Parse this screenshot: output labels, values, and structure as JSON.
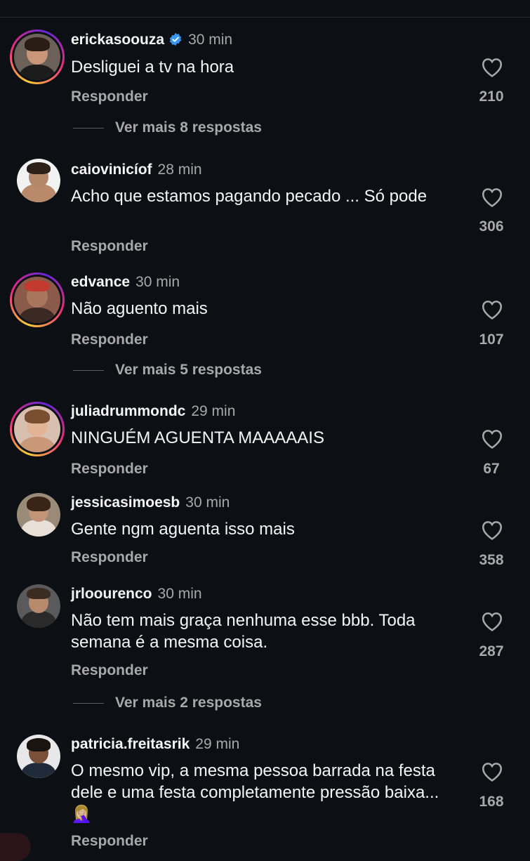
{
  "reply_label": "Responder",
  "comments": [
    {
      "user": "erickasoouza",
      "time": "30 min",
      "verified": true,
      "text": "Desliguei a tv na hora",
      "likes": "210",
      "more": "Ver mais 8 respostas"
    },
    {
      "user": "caiovinicíof",
      "time": "28 min",
      "verified": false,
      "text": "Acho que estamos pagando  pecado ... Só pode",
      "likes": "306"
    },
    {
      "user": "edvance",
      "time": "30 min",
      "verified": false,
      "text": "Não aguento mais",
      "likes": "107",
      "more": "Ver mais 5 respostas"
    },
    {
      "user": "juliadrummondc",
      "time": "29 min",
      "verified": false,
      "text": "NINGUÉM AGUENTA MAAAAAIS",
      "likes": "67"
    },
    {
      "user": "jessicasimoesb",
      "time": "30 min",
      "verified": false,
      "text": "Gente ngm aguenta isso mais",
      "likes": "358"
    },
    {
      "user": "jrloourenco",
      "time": "30 min",
      "verified": false,
      "text": "Não tem mais graça nenhuma esse bbb. Toda semana é a mesma coisa.",
      "likes": "287",
      "more": "Ver mais 2 respostas"
    },
    {
      "user": "patricia.freitasrik",
      "time": "29 min",
      "verified": false,
      "text": "O mesmo vip, a mesma pessoa barrada na festa dele e uma festa completamente pressão baixa... 🤦🏼‍♀️",
      "likes": "168"
    }
  ],
  "colors": {
    "background": "#0c0f14",
    "primary_text": "#f5f5f5",
    "secondary_text": "#a8a8a8",
    "verified_blue": "#3897f0"
  },
  "icons": {
    "like": "heart-outline-icon",
    "verified": "verified-badge-icon"
  }
}
